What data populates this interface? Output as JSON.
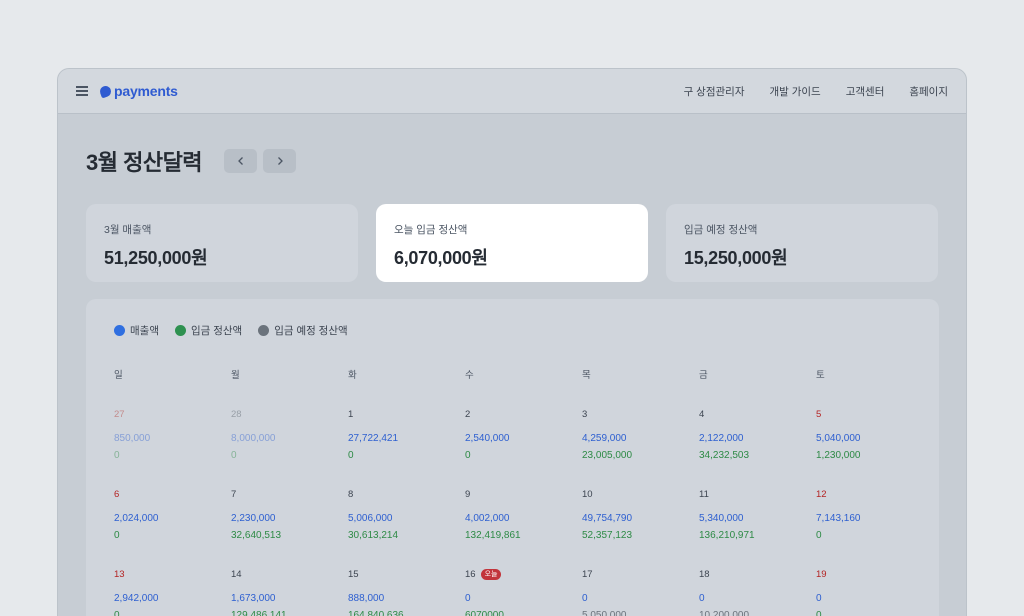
{
  "header": {
    "logo_text": "payments",
    "nav": [
      "구 상점관리자",
      "개발 가이드",
      "고객센터",
      "홈페이지"
    ]
  },
  "page": {
    "title": "3월 정산달력"
  },
  "cards": [
    {
      "label": "3월 매출액",
      "value": "51,250,000원",
      "active": false
    },
    {
      "label": "오늘 입금 정산액",
      "value": "6,070,000원",
      "active": true
    },
    {
      "label": "입금 예정 정산액",
      "value": "15,250,000원",
      "active": false
    }
  ],
  "legend": [
    {
      "label": "매출액",
      "color": "#2f6fe0"
    },
    {
      "label": "입금 정산액",
      "color": "#2e9150"
    },
    {
      "label": "입금 예정 정산액",
      "color": "#6b737c"
    }
  ],
  "weekdays": [
    "일",
    "월",
    "화",
    "수",
    "목",
    "금",
    "토"
  ],
  "today_label": "오늘",
  "weeks": [
    [
      {
        "day": "27",
        "sales": "850,000",
        "deposit": "0",
        "type": "prev-sun"
      },
      {
        "day": "28",
        "sales": "8,000,000",
        "deposit": "0",
        "type": "prev"
      },
      {
        "day": "1",
        "sales": "27,722,421",
        "deposit": "0"
      },
      {
        "day": "2",
        "sales": "2,540,000",
        "deposit": "0"
      },
      {
        "day": "3",
        "sales": "4,259,000",
        "deposit": "23,005,000"
      },
      {
        "day": "4",
        "sales": "2,122,000",
        "deposit": "34,232,503"
      },
      {
        "day": "5",
        "sales": "5,040,000",
        "deposit": "1,230,000",
        "type": "weekend"
      }
    ],
    [
      {
        "day": "6",
        "sales": "2,024,000",
        "deposit": "0",
        "type": "weekend"
      },
      {
        "day": "7",
        "sales": "2,230,000",
        "deposit": "32,640,513"
      },
      {
        "day": "8",
        "sales": "5,006,000",
        "deposit": "30,613,214"
      },
      {
        "day": "9",
        "sales": "4,002,000",
        "deposit": "132,419,861"
      },
      {
        "day": "10",
        "sales": "49,754,790",
        "deposit": "52,357,123"
      },
      {
        "day": "11",
        "sales": "5,340,000",
        "deposit": "136,210,971"
      },
      {
        "day": "12",
        "sales": "7,143,160",
        "deposit": "0",
        "type": "weekend"
      }
    ],
    [
      {
        "day": "13",
        "sales": "2,942,000",
        "deposit": "0",
        "type": "weekend"
      },
      {
        "day": "14",
        "sales": "1,673,000",
        "deposit": "129,486,141"
      },
      {
        "day": "15",
        "sales": "888,000",
        "deposit": "164,840,636"
      },
      {
        "day": "16",
        "sales": "0",
        "deposit": "6070000",
        "today": true
      },
      {
        "day": "17",
        "sales": "0",
        "deposit": "5,050,000",
        "expected": true
      },
      {
        "day": "18",
        "sales": "0",
        "deposit": "10,200,000",
        "expected": true
      },
      {
        "day": "19",
        "sales": "0",
        "deposit": "0",
        "type": "weekend"
      }
    ]
  ]
}
